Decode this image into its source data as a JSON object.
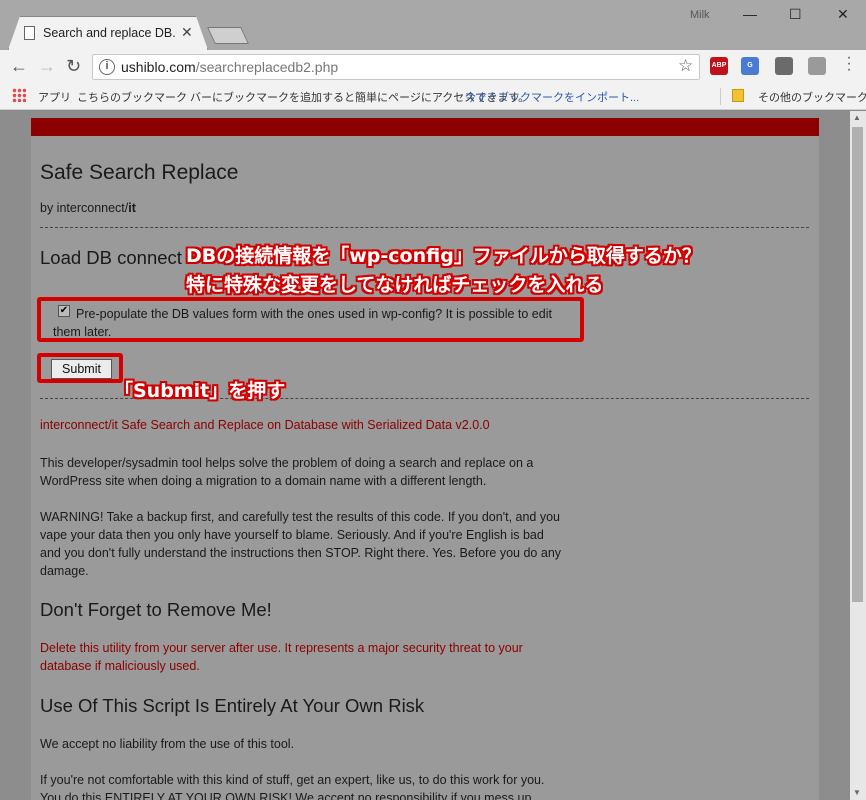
{
  "browser": {
    "tab_title": "Search and replace DB.",
    "tab_close": "✕",
    "user_label": "Milk",
    "window_buttons": [
      "—",
      "☐",
      "✕"
    ],
    "url_domain": "ushiblo.com",
    "url_path": "/searchreplacedb2.php",
    "nav": {
      "back": "←",
      "forward": "→",
      "reload": "↻"
    },
    "info_icon": "i",
    "star": "☆",
    "extensions": [
      {
        "name": "abp-icon",
        "text": "ABP",
        "color": "#c0111a"
      },
      {
        "name": "translate-icon",
        "text": "G",
        "color": "#4a7bd4"
      },
      {
        "name": "screenshot-icon",
        "text": "",
        "color": "#6b6b6b"
      },
      {
        "name": "cloud-icon",
        "text": "",
        "color": "#9a9a9a"
      }
    ],
    "bookmarks": {
      "apps_label": "アプリ",
      "hint": "こちらのブックマーク バーにブックマークを追加すると簡単にページにアクセスできます。",
      "import_link": "今すぐブックマークをインポート...",
      "other": "その他のブックマーク"
    }
  },
  "page": {
    "title": "Safe Search Replace",
    "by_prefix": "by interconnect/",
    "by_bold": "it",
    "load_heading": "Load DB connect",
    "checkbox_checked": true,
    "checkbox_mark": "✔",
    "checkbox_label": "Pre-populate the DB values form with the ones used in wp-config? It is possible to edit them later.",
    "submit_label": "Submit",
    "version_line": "interconnect/it Safe Search and Replace on Database with Serialized Data v2.0.0",
    "intro": "This developer/sysadmin tool helps solve the problem of doing a search and replace on a WordPress site when doing a migration to a domain name with a different length.",
    "warning": "WARNING! Take a backup first, and carefully test the results of this code. If you don't, and you vape your data then you only have yourself to blame. Seriously. And if you're English is bad and you don't fully understand the instructions then STOP. Right there. Yes. Before you do any damage.",
    "remove_heading": "Don't Forget to Remove Me!",
    "remove_text": "Delete this utility from your server after use. It represents a major security threat to your database if maliciously used.",
    "risk_heading": "Use Of This Script Is Entirely At Your Own Risk",
    "liability": "We accept no liability from the use of this tool.",
    "expert": "If you're not comfortable with this kind of stuff, get an expert, like us, to do this work for you. You do this ENTIRELY AT YOUR OWN RISK! We accept no responsibility if you mess up"
  },
  "annotations": {
    "line1": "DBの接続情報を「wp-config」ファイルから取得するか？",
    "line2": "特に特殊な変更をしてなければチェックを入れる",
    "submit_note": "「Submit」を押す",
    "color": "#d40000"
  }
}
